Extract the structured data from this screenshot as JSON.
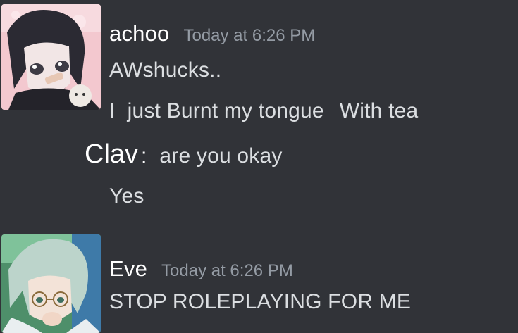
{
  "messages": [
    {
      "author": "achoo",
      "timestamp": "Today at 6:26 PM",
      "lines": [
        "AWshucks..",
        "I  just Burnt my tongue",
        "With tea",
        "Yes"
      ]
    },
    {
      "author": "Eve",
      "timestamp": "Today at 6:26 PM",
      "lines": [
        "STOP ROLEPLAYING FOR ME"
      ]
    }
  ],
  "overlay": {
    "name": "Clav",
    "colon": ":",
    "text": "are you okay"
  },
  "colors": {
    "background": "#313338",
    "username": "#ffffff",
    "timestamp": "#949ba4",
    "message_text": "#dbdee1"
  }
}
